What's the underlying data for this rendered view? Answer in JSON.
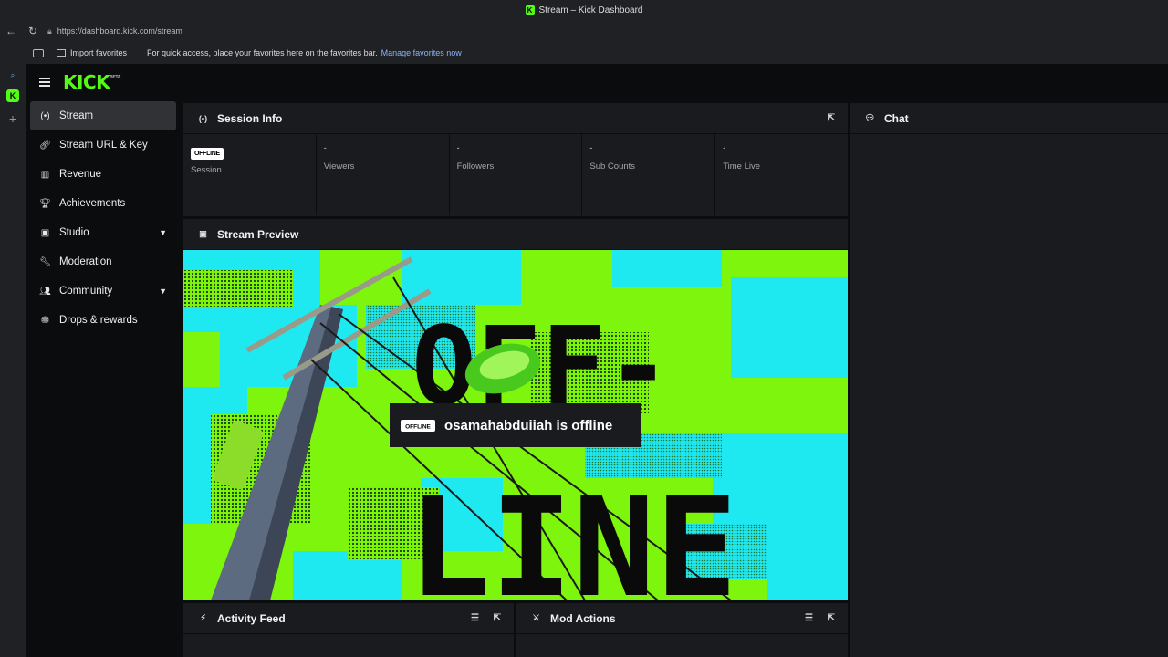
{
  "browser": {
    "window_title": "Stream – Kick Dashboard",
    "url": "https://dashboard.kick.com/stream",
    "favorites": {
      "import_label": "Import favorites",
      "message": "For quick access, place your favorites here on the favorites bar.",
      "link": "Manage favorites now"
    }
  },
  "app": {
    "logo": "KICK",
    "logo_tag": "BETA",
    "sidebar": {
      "items": [
        {
          "label": "Stream",
          "icon": "broadcast-icon",
          "active": true
        },
        {
          "label": "Stream URL & Key",
          "icon": "link-icon"
        },
        {
          "label": "Revenue",
          "icon": "bar-chart-icon"
        },
        {
          "label": "Achievements",
          "icon": "trophy-icon"
        },
        {
          "label": "Studio",
          "icon": "studio-icon",
          "expandable": true
        },
        {
          "label": "Moderation",
          "icon": "wrench-icon"
        },
        {
          "label": "Community",
          "icon": "community-icon",
          "expandable": true
        },
        {
          "label": "Drops & rewards",
          "icon": "drops-icon"
        }
      ]
    },
    "session": {
      "title": "Session Info",
      "status_badge": "OFFLINE",
      "stats": [
        {
          "value": "",
          "label": "Session"
        },
        {
          "value": "-",
          "label": "Viewers"
        },
        {
          "value": "-",
          "label": "Followers"
        },
        {
          "value": "-",
          "label": "Sub Counts"
        },
        {
          "value": "-",
          "label": "Time Live"
        }
      ]
    },
    "preview": {
      "title": "Stream Preview",
      "badge": "OFFLINE",
      "message": "osamahabduiiah is offline",
      "art_text_top": "OFF-",
      "art_text_bottom": "LINE"
    },
    "chat": {
      "title": "Chat"
    },
    "activity": {
      "title": "Activity Feed"
    },
    "mod_actions": {
      "title": "Mod Actions"
    }
  },
  "colors": {
    "accent": "#53fc18",
    "panel": "#191b1f",
    "background": "#0b0c0d"
  }
}
